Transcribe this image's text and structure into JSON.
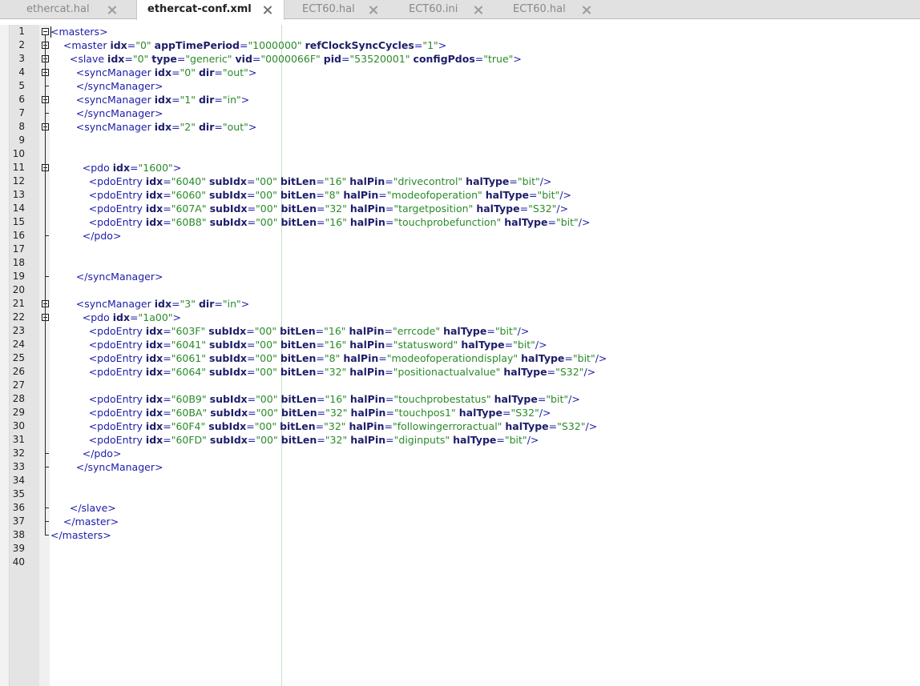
{
  "tabs": [
    {
      "label": "ethercat.hal",
      "active": false
    },
    {
      "label": "ethercat-conf.xml",
      "active": true
    },
    {
      "label": "ECT60.hal",
      "active": false
    },
    {
      "label": "ECT60.ini",
      "active": false
    },
    {
      "label": "ECT60.hal",
      "active": false
    }
  ],
  "colors": {
    "tag": "#1c1ca8",
    "attribute": "#1d1d6a",
    "string": "#2a8a2a",
    "gutter": "#e4e4e4",
    "edge_line": "#c6e3c6"
  },
  "line_numbers": [
    "1",
    "2",
    "3",
    "4",
    "5",
    "6",
    "7",
    "8",
    "9",
    "10",
    "11",
    "12",
    "13",
    "14",
    "15",
    "16",
    "17",
    "18",
    "19",
    "20",
    "21",
    "22",
    "23",
    "24",
    "25",
    "26",
    "27",
    "28",
    "29",
    "30",
    "31",
    "32",
    "33",
    "34",
    "35",
    "36",
    "37",
    "38",
    "39",
    "40"
  ],
  "code_lines": [
    "<masters>",
    "    <master idx=\"0\" appTimePeriod=\"1000000\" refClockSyncCycles=\"1\">",
    "      <slave idx=\"0\" type=\"generic\" vid=\"0000066F\" pid=\"53520001\" configPdos=\"true\">",
    "        <syncManager idx=\"0\" dir=\"out\">",
    "        </syncManager>",
    "        <syncManager idx=\"1\" dir=\"in\">",
    "        </syncManager>",
    "        <syncManager idx=\"2\" dir=\"out\">",
    "",
    "",
    "          <pdo idx=\"1600\">",
    "            <pdoEntry idx=\"6040\" subIdx=\"00\" bitLen=\"16\" halPin=\"drivecontrol\" halType=\"bit\"/>",
    "            <pdoEntry idx=\"6060\" subIdx=\"00\" bitLen=\"8\" halPin=\"modeofoperation\" halType=\"bit\"/>",
    "            <pdoEntry idx=\"607A\" subIdx=\"00\" bitLen=\"32\" halPin=\"targetposition\" halType=\"S32\"/>",
    "            <pdoEntry idx=\"60B8\" subIdx=\"00\" bitLen=\"16\" halPin=\"touchprobefunction\" halType=\"bit\"/>",
    "          </pdo>",
    "",
    "",
    "        </syncManager>",
    "",
    "        <syncManager idx=\"3\" dir=\"in\">",
    "          <pdo idx=\"1a00\">",
    "            <pdoEntry idx=\"603F\" subIdx=\"00\" bitLen=\"16\" halPin=\"errcode\" halType=\"bit\"/>",
    "            <pdoEntry idx=\"6041\" subIdx=\"00\" bitLen=\"16\" halPin=\"statusword\" halType=\"bit\"/>",
    "            <pdoEntry idx=\"6061\" subIdx=\"00\" bitLen=\"8\" halPin=\"modeofoperationdisplay\" halType=\"bit\"/>",
    "            <pdoEntry idx=\"6064\" subIdx=\"00\" bitLen=\"32\" halPin=\"positionactualvalue\" halType=\"S32\"/>",
    "",
    "            <pdoEntry idx=\"60B9\" subIdx=\"00\" bitLen=\"16\" halPin=\"touchprobestatus\" halType=\"bit\"/>",
    "            <pdoEntry idx=\"60BA\" subIdx=\"00\" bitLen=\"32\" halPin=\"touchpos1\" halType=\"S32\"/>",
    "            <pdoEntry idx=\"60F4\" subIdx=\"00\" bitLen=\"32\" halPin=\"followingerroractual\" halType=\"S32\"/>",
    "            <pdoEntry idx=\"60FD\" subIdx=\"00\" bitLen=\"32\" halPin=\"diginputs\" halType=\"bit\"/>",
    "          </pdo>",
    "        </syncManager>",
    "",
    "",
    "      </slave>",
    "    </master>",
    "</masters>",
    "",
    ""
  ]
}
